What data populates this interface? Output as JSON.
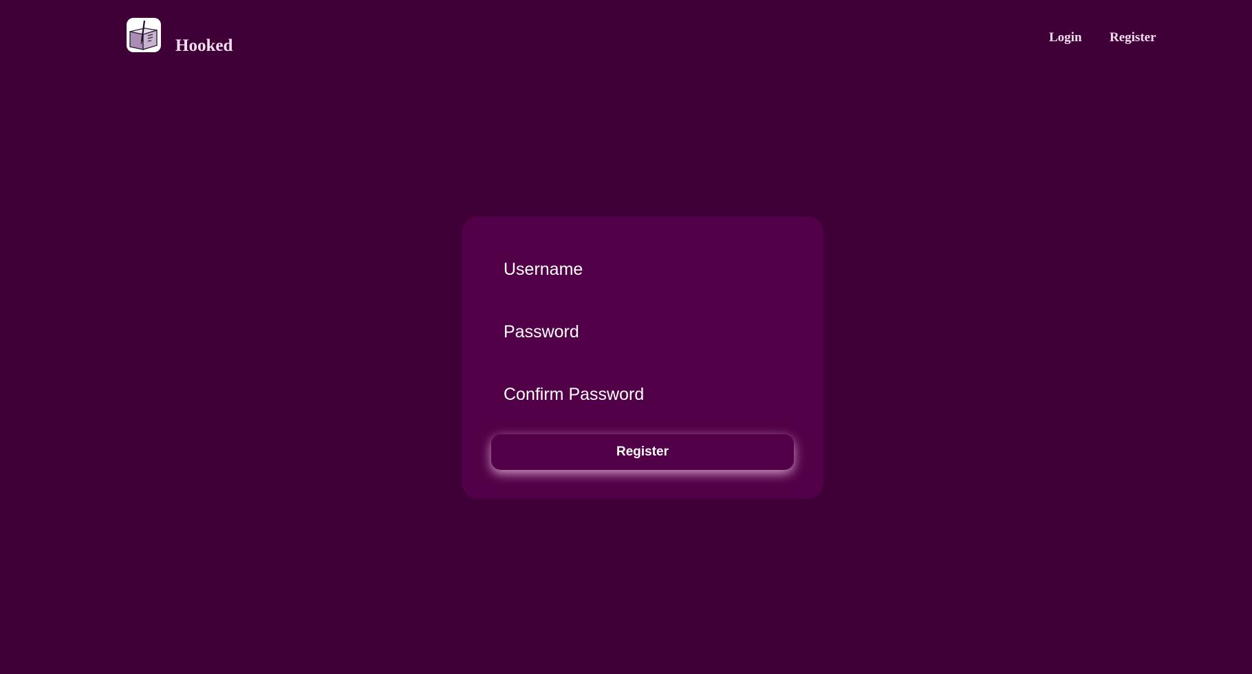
{
  "header": {
    "brand": "Hooked",
    "nav": {
      "login": "Login",
      "register": "Register"
    }
  },
  "form": {
    "username_label": "Username",
    "password_label": "Password",
    "confirm_password_label": "Confirm Password",
    "submit_label": "Register"
  },
  "colors": {
    "page_background": "#3f0038",
    "card_background": "#520047",
    "text": "#ffffff",
    "brand_text": "#f6dff2",
    "button_glow": "#ffd2f5"
  },
  "icons": {
    "logo": "book-with-quill-icon"
  }
}
